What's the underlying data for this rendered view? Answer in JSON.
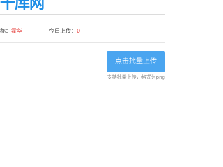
{
  "header": {
    "logo_text": "千库网"
  },
  "user_info": {
    "name_label": "称：",
    "name_value": "霍华",
    "upload_label": "今日上传：",
    "upload_count": "0",
    "value_color": "#e53935"
  },
  "upload": {
    "button_label": "点击批量上传",
    "hint": "支持批量上传，格式为png",
    "button_color": "#4aa5f0"
  }
}
